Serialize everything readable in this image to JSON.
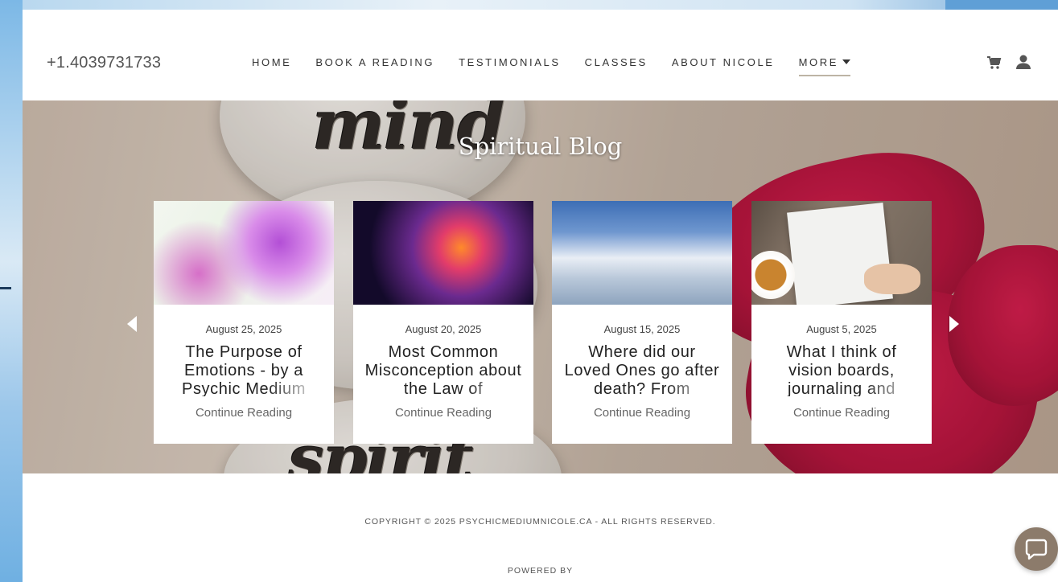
{
  "header": {
    "phone": "+1.4039731733",
    "nav": [
      {
        "label": "HOME"
      },
      {
        "label": "BOOK A READING"
      },
      {
        "label": "TESTIMONIALS"
      },
      {
        "label": "CLASSES"
      },
      {
        "label": "ABOUT NICOLE"
      },
      {
        "label": "MORE",
        "active": true
      }
    ],
    "icons": [
      "cart-icon",
      "user-icon"
    ]
  },
  "hero": {
    "background_words": [
      "mind",
      "spirit"
    ],
    "title": "Spiritual Blog"
  },
  "posts": [
    {
      "date": "August 25, 2025",
      "title": "The Purpose of Emotions - by a Psychic Medium",
      "cta": "Continue Reading"
    },
    {
      "date": "August 20, 2025",
      "title": "Most Common Misconception about the Law of",
      "cta": "Continue Reading"
    },
    {
      "date": "August 15, 2025",
      "title": "Where did our Loved Ones go after death? From",
      "cta": "Continue Reading"
    },
    {
      "date": "August 5, 2025",
      "title": "What I think of vision boards, journaling and",
      "cta": "Continue Reading"
    }
  ],
  "footer": {
    "copyright": "COPYRIGHT © 2025 PSYCHICMEDIUMNICOLE.CA - ALL RIGHTS RESERVED.",
    "powered_by": "POWERED BY"
  },
  "colors": {
    "accent_underline": "#bdb4a5",
    "chat_button": "#8c7b6b",
    "petal": "#b3103b"
  }
}
